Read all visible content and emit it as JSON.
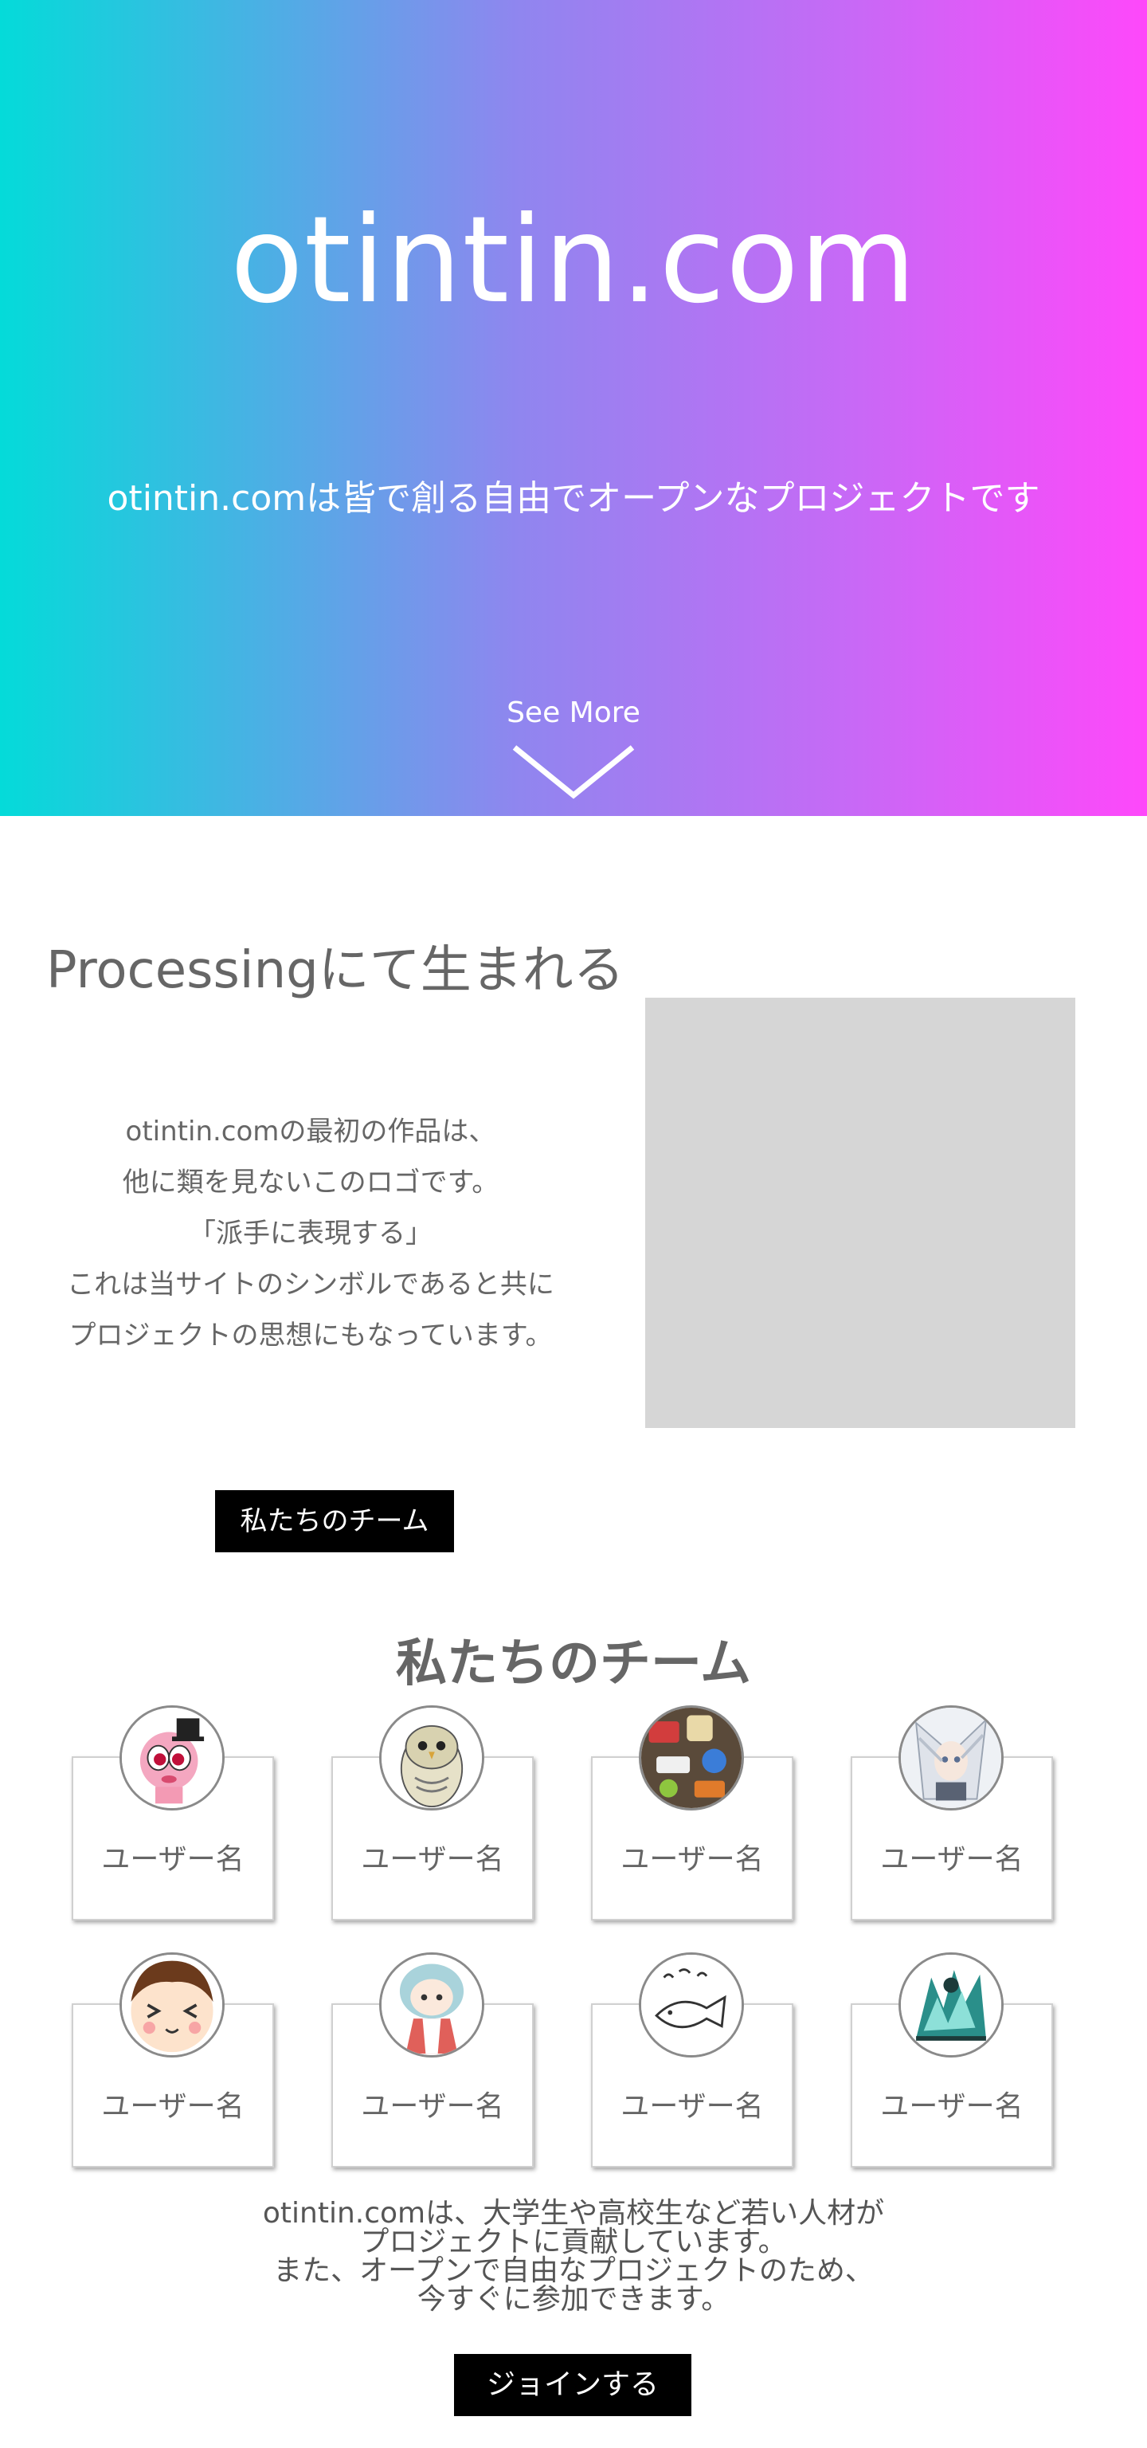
{
  "hero": {
    "title": "otintin.com",
    "subtitle": "otintin.comは皆で創る自由でオープンなプロジェクトです",
    "see_more": "See More",
    "gradient_start": "#04dbd9",
    "gradient_end": "#fe48fa",
    "arrow_icon": "chevron-down-icon"
  },
  "processing": {
    "heading": "Processingにて生まれる",
    "lines": [
      "otintin.comの最初の作品は、",
      "他に類を見ないこのロゴです。",
      "「派手に表現する」",
      "これは当サイトのシンボルであると共に",
      "プロジェクトの思想にもなっています。"
    ],
    "team_button": "私たちのチーム"
  },
  "team": {
    "heading": "私たちのチーム",
    "members": [
      {
        "name": "ユーザー名",
        "avatar": "pink-character-avatar"
      },
      {
        "name": "ユーザー名",
        "avatar": "owl-avatar"
      },
      {
        "name": "ユーザー名",
        "avatar": "sticker-laptop-avatar"
      },
      {
        "name": "ユーザー名",
        "avatar": "white-hair-anime-avatar"
      },
      {
        "name": "ユーザー名",
        "avatar": "smiley-face-avatar"
      },
      {
        "name": "ユーザー名",
        "avatar": "blue-hair-girl-avatar"
      },
      {
        "name": "ユーザー名",
        "avatar": "fish-sketch-avatar"
      },
      {
        "name": "ユーザー名",
        "avatar": "teal-art-avatar"
      }
    ]
  },
  "outro": {
    "lines": [
      "otintin.comは、大学生や高校生など若い人材が",
      "プロジェクトに貢献しています。",
      "また、オープンで自由なプロジェクトのため、",
      "今すぐに参加できます。"
    ],
    "join_button": "ジョインする"
  }
}
